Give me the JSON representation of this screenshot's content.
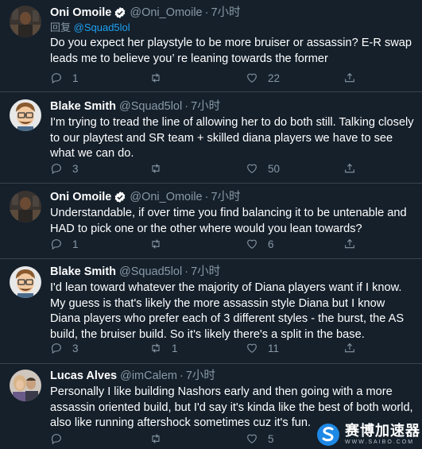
{
  "tweets": [
    {
      "name": "Oni Omoile",
      "verified": true,
      "handle": "@Oni_Omoile",
      "time": "7小时",
      "reply_prefix": "回复",
      "reply_to": "@Squad5lol",
      "text": "Do you expect her playstyle to be more bruiser or assassin? E-R swap leads me to believe you’  re leaning towards the former",
      "replies": "1",
      "retweets": "",
      "likes": "22"
    },
    {
      "name": "Blake Smith",
      "verified": false,
      "handle": "@Squad5lol",
      "time": "7小时",
      "text": "I'm trying to tread the line of allowing her to do both still. Talking closely to our playtest and SR team + skilled diana players we have to see what we can do.",
      "replies": "3",
      "retweets": "",
      "likes": "50"
    },
    {
      "name": "Oni Omoile",
      "verified": true,
      "handle": "@Oni_Omoile",
      "time": "7小时",
      "text": "Understandable, if over time you find balancing it to be untenable and HAD to pick one or the other where would you lean towards?",
      "replies": "1",
      "retweets": "",
      "likes": "6"
    },
    {
      "name": "Blake Smith",
      "verified": false,
      "handle": "@Squad5lol",
      "time": "7小时",
      "text": "I'd lean toward whatever the majority of Diana players want if I know. My guess is that's likely the more assassin style Diana but I know Diana players who prefer each of 3 different styles - the burst, the AS build, the bruiser build. So it's likely there's a split in the base.",
      "replies": "3",
      "retweets": "1",
      "likes": "11"
    },
    {
      "name": "Lucas Alves",
      "verified": false,
      "handle": "@imCalem",
      "time": "7小时",
      "text": "Personally I like building Nashors early and then going with a more assassin oriented build, but I'd say it's kinda like the best of both world, also like running aftershock sometimes cuz it's fun.",
      "replies": "",
      "retweets": "",
      "likes": "5"
    }
  ],
  "watermark": {
    "cn": "赛博加速器",
    "en": "WWW.SAIBO.COM"
  },
  "colors": {
    "background": "#15202b",
    "secondary_text": "#8899a6",
    "link": "#1da1f2",
    "divider": "#38444d"
  }
}
